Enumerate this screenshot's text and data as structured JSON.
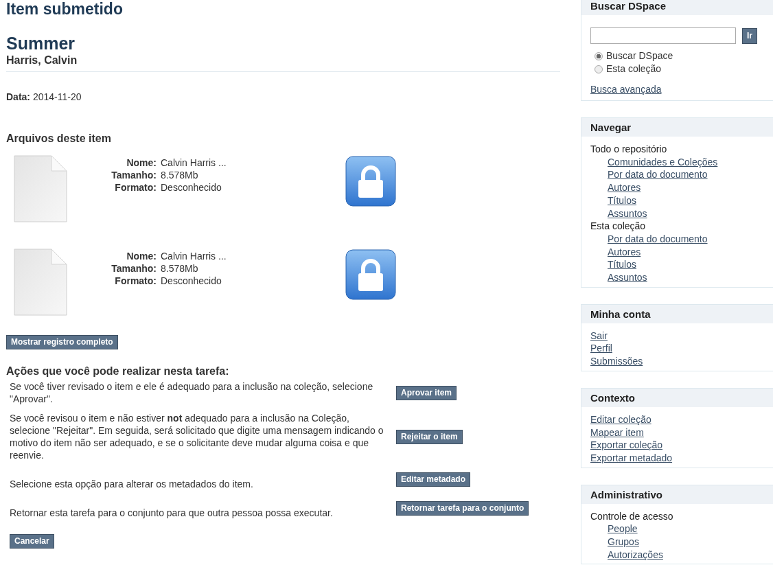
{
  "page_title": "Item submetido",
  "item": {
    "title": "Summer",
    "author": "Harris, Calvin",
    "date_label": "Data:",
    "date": "2014-11-20"
  },
  "files": {
    "heading": "Arquivos deste item",
    "items": [
      {
        "fields": [
          {
            "label": "Nome:",
            "value": "Calvin Harris ..."
          },
          {
            "label": "Tamanho:",
            "value": "8.578Mb"
          },
          {
            "label": "Formato:",
            "value": "Desconhecido"
          }
        ]
      },
      {
        "fields": [
          {
            "label": "Nome:",
            "value": "Calvin Harris ..."
          },
          {
            "label": "Tamanho:",
            "value": "8.578Mb"
          },
          {
            "label": "Formato:",
            "value": "Desconhecido"
          }
        ]
      }
    ]
  },
  "show_full_button": "Mostrar registro completo",
  "actions": {
    "heading": "Ações que você pode realizar nesta tarefa:",
    "rows": [
      {
        "text": "Se você tiver revisado o item e ele é adequado para a inclusão na coleção, selecione \"Aprovar\".",
        "button": "Aprovar item"
      },
      {
        "text": "Se você revisou o item e não estiver **not** adequado para a inclusão na Coleção, selecione \"Rejeitar\". Em seguida, será solicitado que digite uma mensagem indicando o motivo do item não ser adequado, e se o solicitante deve mudar alguma coisa e que reenvie.",
        "button": "Rejeitar o item"
      },
      {
        "text": "Selecione esta opção para alterar os metadados do item.",
        "button": "Editar metadado"
      },
      {
        "text": "Retornar esta tarefa para o conjunto para que outra pessoa possa executar.",
        "button": "Retornar tarefa para o conjunto"
      }
    ]
  },
  "cancel_button": "Cancelar",
  "sidebar": {
    "search": {
      "title": "Buscar DSpace",
      "button": "Ir",
      "scopes": [
        {
          "label": "Buscar DSpace",
          "selected": true
        },
        {
          "label": "Esta coleção",
          "selected": false
        }
      ],
      "advanced_link": "Busca avançada"
    },
    "panels": [
      {
        "title": "Navegar",
        "items": [
          {
            "kind": "label",
            "text": "Todo o repositório",
            "children": [
              {
                "kind": "link",
                "text": "Comunidades e Coleções"
              },
              {
                "kind": "link",
                "text": "Por data do documento"
              },
              {
                "kind": "link",
                "text": "Autores"
              },
              {
                "kind": "link",
                "text": "Títulos"
              },
              {
                "kind": "link",
                "text": "Assuntos"
              }
            ]
          },
          {
            "kind": "label",
            "text": "Esta coleção",
            "children": [
              {
                "kind": "link",
                "text": "Por data do documento"
              },
              {
                "kind": "link",
                "text": "Autores"
              },
              {
                "kind": "link",
                "text": "Títulos"
              },
              {
                "kind": "link",
                "text": "Assuntos"
              }
            ]
          }
        ]
      },
      {
        "title": "Minha conta",
        "items": [
          {
            "kind": "link",
            "text": "Sair"
          },
          {
            "kind": "link",
            "text": "Perfil"
          },
          {
            "kind": "link",
            "text": "Submissões"
          }
        ]
      },
      {
        "title": "Contexto",
        "items": [
          {
            "kind": "link",
            "text": "Editar coleção"
          },
          {
            "kind": "link",
            "text": "Mapear item"
          },
          {
            "kind": "link",
            "text": "Exportar coleção"
          },
          {
            "kind": "link",
            "text": "Exportar metadado"
          }
        ]
      },
      {
        "title": "Administrativo",
        "items": [
          {
            "kind": "label",
            "text": "Controle de acesso",
            "children": [
              {
                "kind": "link",
                "text": "People"
              },
              {
                "kind": "link",
                "text": "Grupos"
              },
              {
                "kind": "link",
                "text": "Autorizações"
              }
            ]
          }
        ]
      }
    ]
  }
}
